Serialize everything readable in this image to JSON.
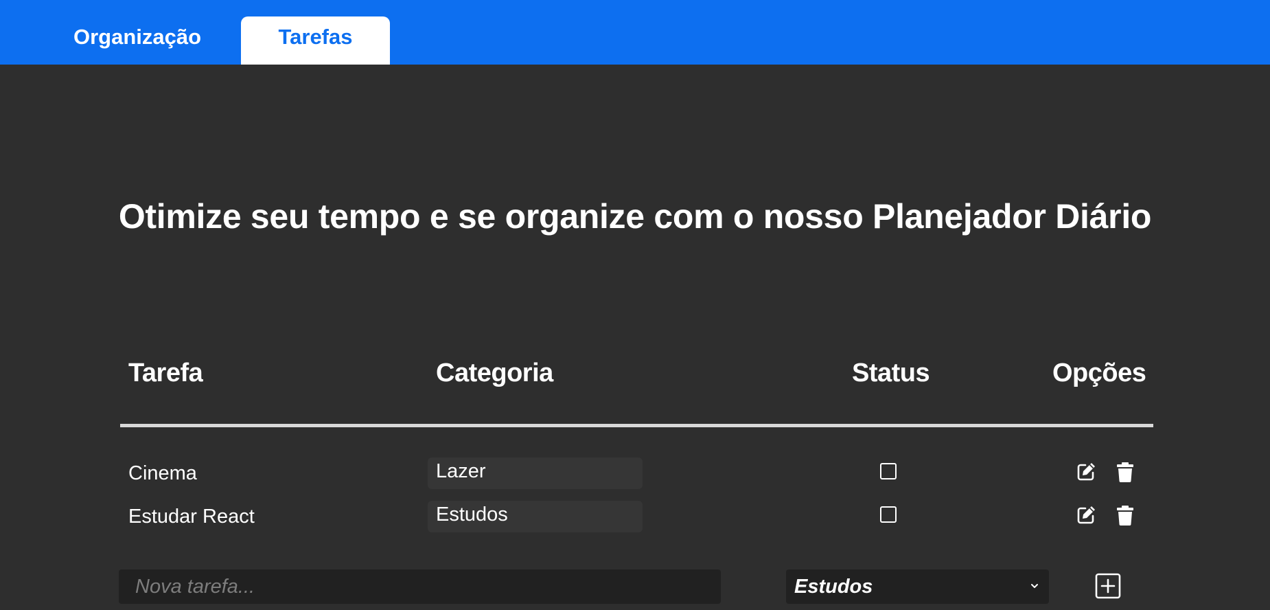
{
  "nav": {
    "tabs": [
      {
        "label": "Organização",
        "active": false
      },
      {
        "label": "Tarefas",
        "active": true
      }
    ]
  },
  "headline": "Otimize seu tempo e se organize com o nosso Planejador Diário",
  "table": {
    "headers": {
      "task": "Tarefa",
      "category": "Categoria",
      "status": "Status",
      "options": "Opções"
    },
    "rows": [
      {
        "task": "Cinema",
        "category": "Lazer",
        "done": false,
        "icons": [
          "edit-icon",
          "trash-icon"
        ]
      },
      {
        "task": "Estudar React",
        "category": "Estudos",
        "done": false,
        "icons": [
          "edit-icon",
          "trash-icon"
        ]
      }
    ]
  },
  "new_task": {
    "placeholder": "Nova tarefa...",
    "value": "",
    "category_selected": "Estudos",
    "add_icon": "plus-square-icon"
  },
  "colors": {
    "primary": "#0d6ff0",
    "background": "#2e2e2e",
    "input_background": "#212121",
    "text": "#ffffff"
  }
}
